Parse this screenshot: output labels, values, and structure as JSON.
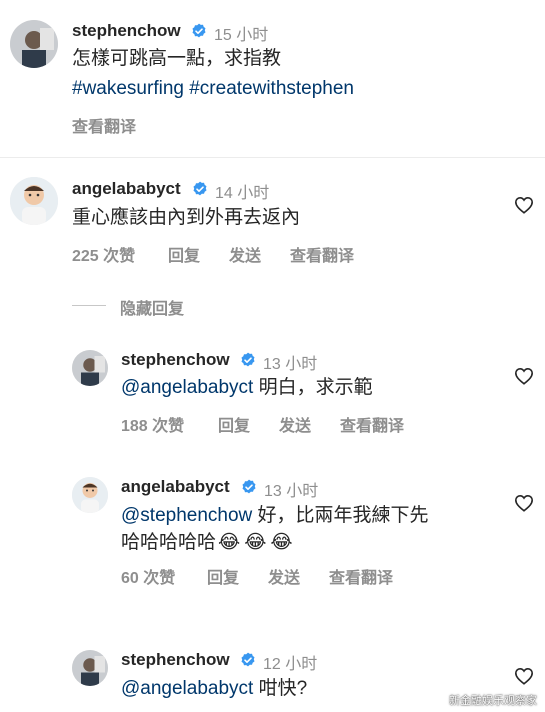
{
  "comments": [
    {
      "username": "stephenchow",
      "time": "15 小时",
      "text": "怎樣可跳高一點，求指教",
      "hashtags": "#wakesurfing #createwithstephen",
      "translate": "查看翻译"
    },
    {
      "username": "angelababyct",
      "time": "14 小时",
      "text": "重心應該由內到外再去返內",
      "likes": "225 次赞",
      "reply": "回复",
      "send": "发送",
      "translate": "查看翻译"
    }
  ],
  "hide_replies": "隐藏回复",
  "replies": [
    {
      "username": "stephenchow",
      "time": "13 小时",
      "mention": "@angelababyct",
      "text": " 明白，求示範",
      "likes": "188 次赞",
      "reply": "回复",
      "send": "发送",
      "translate": "查看翻译"
    },
    {
      "username": "angelababyct",
      "time": "13 小时",
      "mention": "@stephenchow",
      "text": " 好，比兩年我練下先",
      "text2": "哈哈哈哈哈",
      "emojis": "😂😂😂",
      "likes": "60 次赞",
      "reply": "回复",
      "send": "发送",
      "translate": "查看翻译"
    },
    {
      "username": "stephenchow",
      "time": "12 小时",
      "mention": "@angelababyct",
      "text": " 咁快?"
    }
  ],
  "watermark": "新金融娱乐观察家",
  "colors": {
    "text": "#262626",
    "muted": "#8e8e8e",
    "link": "#00376b",
    "verified": "#3897f0"
  },
  "icons": {
    "verified": "verified-badge-icon",
    "like": "heart-outline-icon"
  }
}
